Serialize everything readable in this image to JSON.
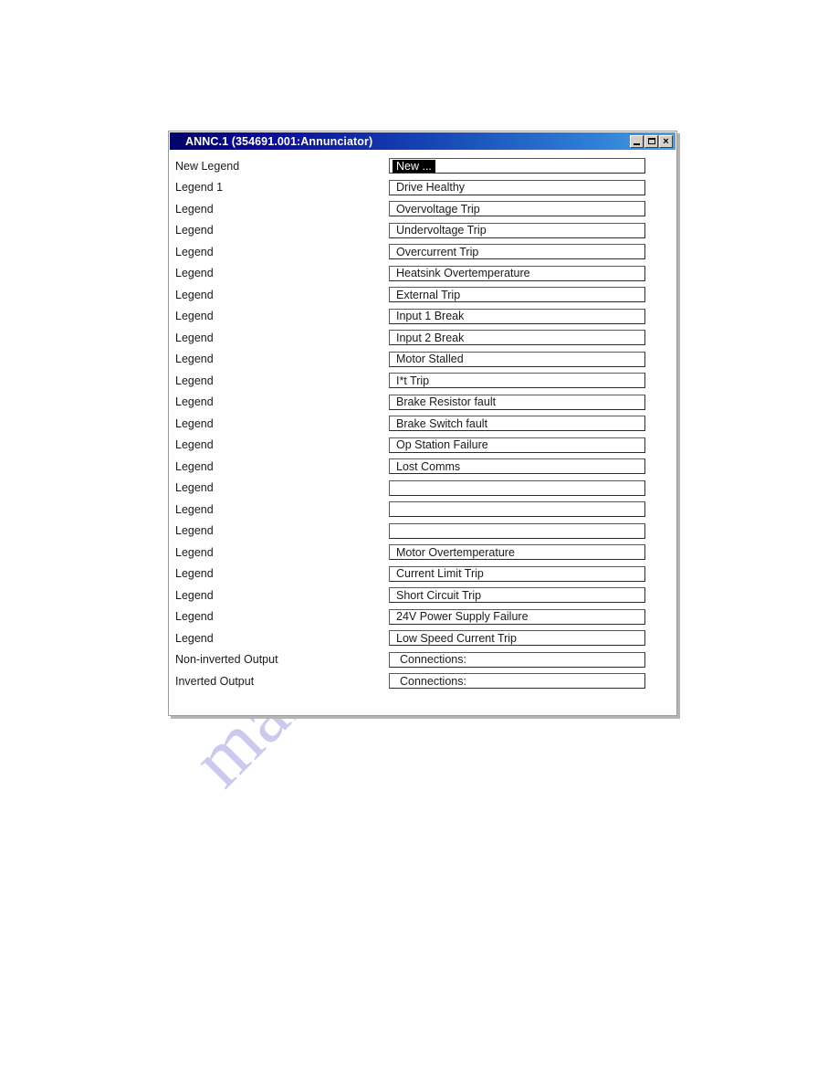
{
  "window": {
    "title": "ANNC.1 (354691.001:Annunciator)",
    "controls": {
      "minimize_label": "_",
      "maximize_label": "□",
      "close_label": "×"
    }
  },
  "watermark": {
    "text": "manualshive.com"
  },
  "colors": {
    "title_bar_start": "#03036b",
    "title_bar_end": "#4aa0e6",
    "title_text": "#ffffff",
    "selection_bg": "#000000",
    "selection_fg": "#ffffff",
    "window_bg": "#ffffff",
    "field_border": "#2b2b2b"
  },
  "rows": [
    {
      "label": "New Legend",
      "value": "New ...",
      "selected": true,
      "indented": false
    },
    {
      "label": "Legend 1",
      "value": "Drive Healthy",
      "selected": false,
      "indented": false
    },
    {
      "label": "Legend",
      "value": "Overvoltage Trip",
      "selected": false,
      "indented": false
    },
    {
      "label": "Legend",
      "value": "Undervoltage Trip",
      "selected": false,
      "indented": false
    },
    {
      "label": "Legend",
      "value": "Overcurrent Trip",
      "selected": false,
      "indented": false
    },
    {
      "label": "Legend",
      "value": "Heatsink Overtemperature",
      "selected": false,
      "indented": false
    },
    {
      "label": "Legend",
      "value": "External Trip",
      "selected": false,
      "indented": false
    },
    {
      "label": "Legend",
      "value": "Input 1 Break",
      "selected": false,
      "indented": false
    },
    {
      "label": "Legend",
      "value": "Input 2 Break",
      "selected": false,
      "indented": false
    },
    {
      "label": "Legend",
      "value": "Motor Stalled",
      "selected": false,
      "indented": false
    },
    {
      "label": "Legend",
      "value": "I*t Trip",
      "selected": false,
      "indented": false
    },
    {
      "label": "Legend",
      "value": "Brake Resistor fault",
      "selected": false,
      "indented": false
    },
    {
      "label": "Legend",
      "value": "Brake Switch fault",
      "selected": false,
      "indented": false
    },
    {
      "label": "Legend",
      "value": "Op Station Failure",
      "selected": false,
      "indented": false
    },
    {
      "label": "Legend",
      "value": "Lost Comms",
      "selected": false,
      "indented": false
    },
    {
      "label": "Legend",
      "value": "",
      "selected": false,
      "indented": false
    },
    {
      "label": "Legend",
      "value": "",
      "selected": false,
      "indented": false
    },
    {
      "label": "Legend",
      "value": "",
      "selected": false,
      "indented": false
    },
    {
      "label": "Legend",
      "value": "Motor Overtemperature",
      "selected": false,
      "indented": false
    },
    {
      "label": "Legend",
      "value": "Current Limit Trip",
      "selected": false,
      "indented": false
    },
    {
      "label": "Legend",
      "value": "Short Circuit Trip",
      "selected": false,
      "indented": false
    },
    {
      "label": "Legend",
      "value": "24V Power Supply Failure",
      "selected": false,
      "indented": false
    },
    {
      "label": "Legend",
      "value": "Low Speed Current Trip",
      "selected": false,
      "indented": false
    },
    {
      "label": "Non-inverted Output",
      "value": "Connections:",
      "selected": false,
      "indented": true
    },
    {
      "label": "Inverted Output",
      "value": "Connections:",
      "selected": false,
      "indented": true
    }
  ]
}
